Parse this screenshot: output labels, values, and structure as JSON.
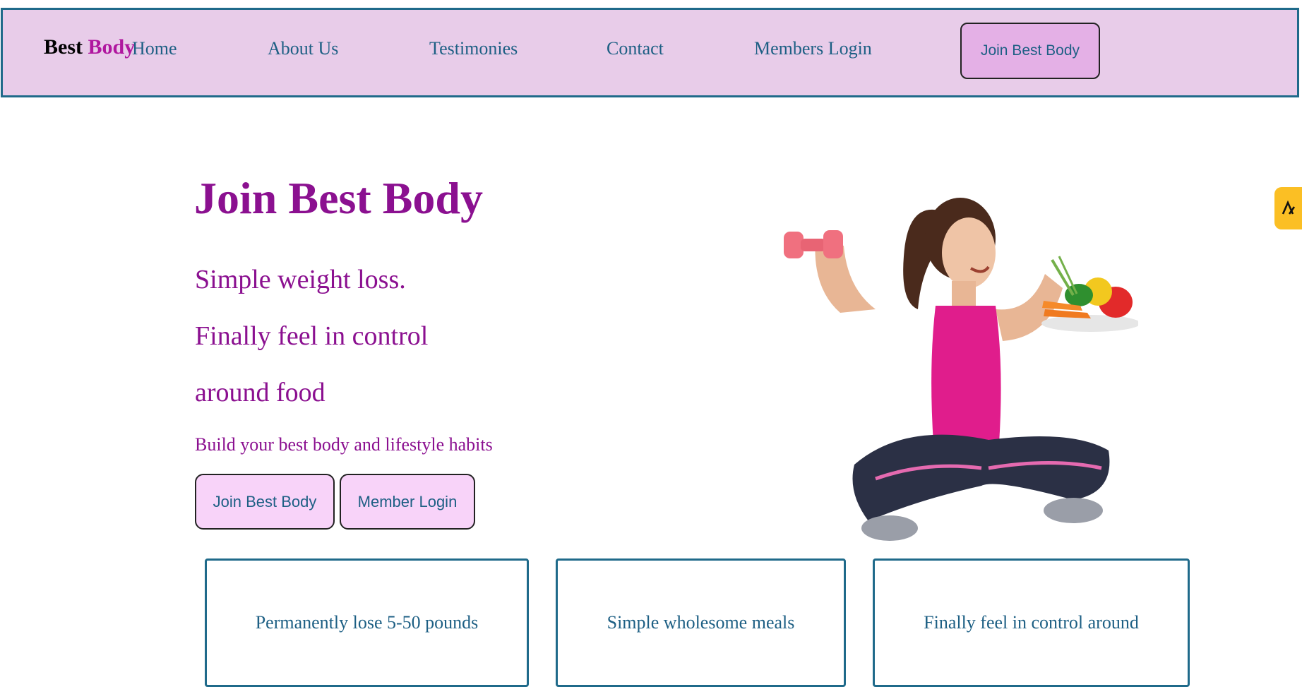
{
  "nav": {
    "brand_part1": "Best",
    "brand_part2": "Body",
    "links": [
      "Home",
      "About Us",
      "Testimonies",
      "Contact",
      "Members Login"
    ],
    "join_button": "Join Best Body"
  },
  "hero": {
    "title": "Join Best Body",
    "lines": [
      "Simple weight loss.",
      "Finally feel in control",
      "around food"
    ],
    "subtitle": "Build your best body and lifestyle habits",
    "buttons": [
      "Join Best Body",
      "Member Login"
    ],
    "image_icon": "woman-fitness-illustration"
  },
  "features": [
    "Permanently lose 5-50 pounds",
    "Simple wholesome meals",
    "Finally feel in control around"
  ],
  "widget": {
    "icon": "tab-widget-icon"
  },
  "colors": {
    "nav_bg": "#e8cce9",
    "nav_border": "#1f6a8a",
    "brand_accent": "#b0179f",
    "hero_text": "#8b1090",
    "link": "#1d5f84",
    "cta_bg": "#f8d3f9",
    "nav_join_bg": "#e4b0e6",
    "widget_bg": "#fbbf24"
  }
}
